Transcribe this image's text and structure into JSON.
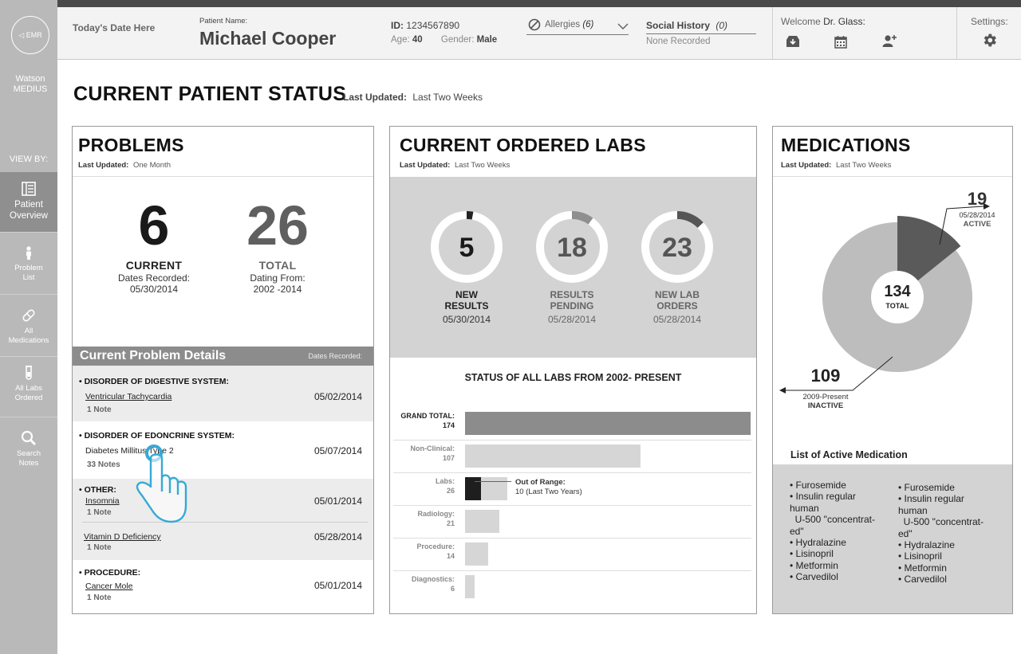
{
  "sidebar": {
    "emr_label": "◁ EMR",
    "brand": "Watson MEDIUS",
    "view_by": "VIEW BY:",
    "items": [
      {
        "label": "Patient Overview",
        "icon": "overview-icon"
      },
      {
        "label": "Problem List",
        "icon": "person-icon"
      },
      {
        "label": "All Medications",
        "icon": "pill-icon"
      },
      {
        "label": "All Labs Ordered",
        "icon": "test-tube-icon"
      },
      {
        "label": "Search Notes",
        "icon": "search-icon"
      }
    ]
  },
  "header": {
    "date": "Today's Date Here",
    "patient_label": "Patient Name:",
    "patient_name": "Michael Cooper",
    "id_label": "ID:",
    "id_value": "1234567890",
    "age_label": "Age:",
    "age_value": "40",
    "gender_label": "Gender:",
    "gender_value": "Male",
    "allergies_label": "Allergies",
    "allergies_count": "(6)",
    "social_label": "Social History",
    "social_count": "(0)",
    "social_value": "None Recorded",
    "welcome_label": "Welcome",
    "welcome_name": "Dr. Glass:",
    "settings_label": "Settings:"
  },
  "page": {
    "title": "CURRENT PATIENT STATUS",
    "updated_label": "Last Updated:",
    "updated_value": "Last Two Weeks"
  },
  "problems": {
    "title": "PROBLEMS",
    "updated_label": "Last Updated:",
    "updated_value": "One Month",
    "current_value": "6",
    "current_label": "CURRENT",
    "current_sub1": "Dates Recorded:",
    "current_sub2": "05/30/2014",
    "total_value": "26",
    "total_label": "TOTAL",
    "total_sub1": "Dating From:",
    "total_sub2": "2002 -2014",
    "details_title": "Current Problem Details",
    "details_dates": "Dates Recorded:",
    "categories": [
      {
        "name": "• DISORDER OF DIGESTIVE SYSTEM:",
        "items": [
          {
            "name": "Ventricular Tachycardia",
            "note": "1 Note",
            "date": "05/02/2014"
          }
        ]
      },
      {
        "name": "• DISORDER OF EDONCRINE SYSTEM:",
        "items": [
          {
            "name": "Diabetes Millitus Type 2",
            "note": "33 Notes",
            "date": "05/07/2014"
          }
        ]
      },
      {
        "name": "• OTHER:",
        "items": [
          {
            "name": "Insomnia",
            "note": "1 Note",
            "date": "05/01/2014"
          },
          {
            "name": "Vitamin D Deficiency",
            "note": "1 Note",
            "date": "05/28/2014"
          }
        ]
      },
      {
        "name": "• PROCEDURE:",
        "items": [
          {
            "name": "Cancer Mole",
            "note": "1 Note",
            "date": "05/01/2014"
          }
        ]
      }
    ]
  },
  "labs": {
    "title": "CURRENT ORDERED LABS",
    "updated_label": "Last Updated:",
    "updated_value": "Last Two Weeks",
    "donuts": [
      {
        "value": "5",
        "label1": "NEW",
        "label2": "RESULTS",
        "date": "05/30/2014",
        "fraction": 0.03,
        "color": "#222222"
      },
      {
        "value": "18",
        "label1": "RESULTS",
        "label2": "PENDING",
        "date": "05/28/2014",
        "fraction": 0.1,
        "color": "#8f8f8f"
      },
      {
        "value": "23",
        "label1": "NEW LAB",
        "label2": "ORDERS",
        "date": "05/28/2014",
        "fraction": 0.13,
        "color": "#555555"
      }
    ],
    "status_title": "STATUS OF ALL LABS FROM 2002- PRESENT",
    "out_of_range_label": "Out of Range:",
    "out_of_range_value": "10 (Last Two Years)",
    "out_of_range": 10
  },
  "chart_data": {
    "type": "bar",
    "title": "STATUS OF ALL LABS FROM 2002- PRESENT",
    "categories": [
      "GRAND TOTAL:",
      "Non-Clinical:",
      "Labs:",
      "Radiology:",
      "Procedure:",
      "Diagnostics:"
    ],
    "values": [
      174,
      107,
      26,
      21,
      14,
      6
    ],
    "value_labels": [
      "174",
      "107",
      "26",
      "21",
      "14",
      "6"
    ],
    "colors": [
      "#8c8c8c",
      "#d6d6d6",
      "#d6d6d6",
      "#d6d6d6",
      "#d6d6d6",
      "#d6d6d6"
    ],
    "xlim": [
      0,
      174
    ]
  },
  "medications": {
    "title": "MEDICATIONS",
    "updated_label": "Last Updated:",
    "updated_value": "Last Two Weeks",
    "active_value": "19",
    "active_date": "05/28/2014",
    "active_label": "ACTIVE",
    "inactive_value": "109",
    "inactive_date": "2009-Present",
    "inactive_label": "INACTIVE",
    "total_value": "134",
    "total_label": "TOTAL",
    "active_fraction": 0.142,
    "active_color": "#5a5a5a",
    "inactive_color": "#bdbdbd",
    "list_title": "List of Active Medication",
    "list_col1": [
      "• Furosemide",
      "• Insulin regular",
      "human",
      "  U-500 \"concentrat-",
      "ed\"",
      "• Hydralazine",
      "• Lisinopril",
      "• Metformin",
      "• Carvedilol"
    ],
    "list_col2": [
      "• Furosemide",
      "• Insulin regular",
      "human",
      "  U-500 \"concentrat-",
      "ed\"",
      "• Hydralazine",
      "• Lisinopril",
      "• Metformin",
      "• Carvedilol"
    ]
  }
}
